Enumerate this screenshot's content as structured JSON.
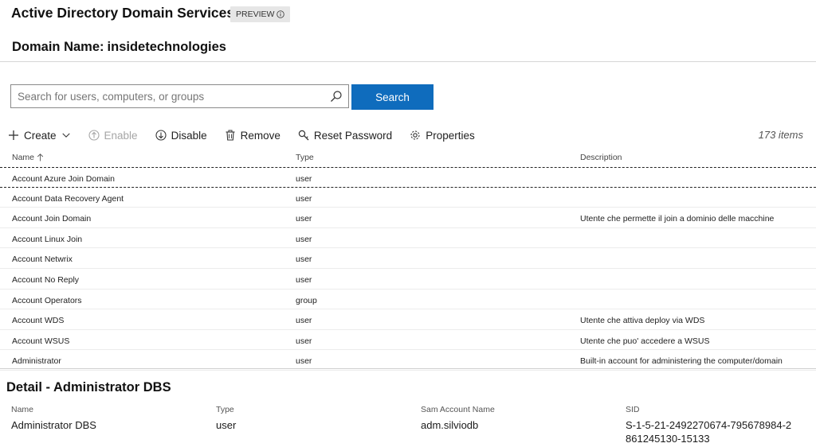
{
  "header": {
    "title": "Active Directory Domain Services",
    "badge": "PREVIEW",
    "domain_label": "Domain Name:",
    "domain_value": "insidetechnologies"
  },
  "search": {
    "placeholder": "Search for users, computers, or groups",
    "value": "",
    "button_label": "Search"
  },
  "toolbar": {
    "create": "Create",
    "enable": "Enable",
    "disable": "Disable",
    "remove": "Remove",
    "reset_password": "Reset Password",
    "properties": "Properties",
    "count": "173 items"
  },
  "table": {
    "columns": [
      "Name",
      "Type",
      "Description"
    ],
    "rows": [
      {
        "name": "Account Azure Join Domain",
        "type": "user",
        "description": ""
      },
      {
        "name": "Account Data Recovery Agent",
        "type": "user",
        "description": ""
      },
      {
        "name": "Account Join Domain",
        "type": "user",
        "description": "Utente che permette il join a dominio delle macchine"
      },
      {
        "name": "Account Linux Join",
        "type": "user",
        "description": ""
      },
      {
        "name": "Account Netwrix",
        "type": "user",
        "description": ""
      },
      {
        "name": "Account No Reply",
        "type": "user",
        "description": ""
      },
      {
        "name": "Account Operators",
        "type": "group",
        "description": ""
      },
      {
        "name": "Account WDS",
        "type": "user",
        "description": "Utente che attiva deploy via WDS"
      },
      {
        "name": "Account WSUS",
        "type": "user",
        "description": "Utente che puo' accedere a WSUS"
      },
      {
        "name": "Administrator",
        "type": "user",
        "description": "Built-in account for administering the computer/domain"
      }
    ]
  },
  "detail": {
    "title": "Detail - Administrator DBS",
    "fields": [
      {
        "label": "Name",
        "value": "Administrator DBS"
      },
      {
        "label": "Type",
        "value": "user"
      },
      {
        "label": "Sam Account Name",
        "value": "adm.silviodb"
      },
      {
        "label": "SID",
        "value": "S-1-5-21-2492270674-795678984-2861245130-15133"
      }
    ]
  },
  "colors": {
    "accent": "#0f6cbd",
    "disabled_text": "#a6a6a6"
  }
}
